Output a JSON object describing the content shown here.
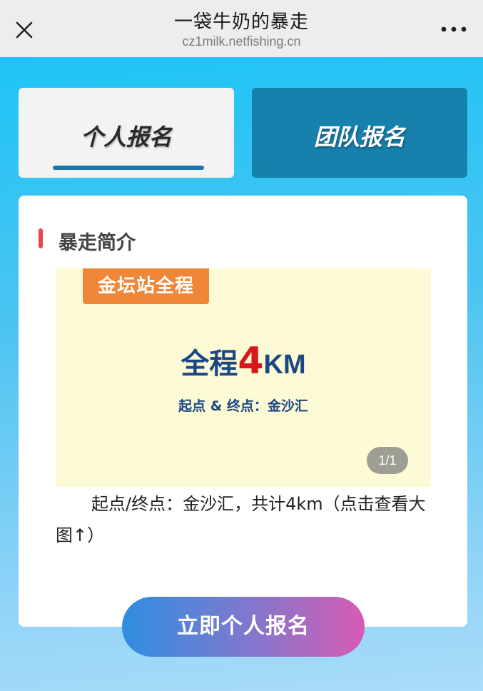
{
  "header": {
    "title": "一袋牛奶的暴走",
    "url": "cz1milk.netfishing.cn",
    "close_icon": "close-icon",
    "more_icon": "more-dots-icon"
  },
  "tabs": [
    {
      "label": "个人报名",
      "active": true
    },
    {
      "label": "团队报名",
      "active": false
    }
  ],
  "section": {
    "title": "暴走简介"
  },
  "promo": {
    "badge": "金坛站全程",
    "main_prefix": "全程",
    "main_number": "4",
    "main_unit": "KM",
    "subtitle": "起点 & 终点：金沙汇",
    "counter": "1/1"
  },
  "description": "起点/终点：金沙汇，共计4km（点击查看大图↑）",
  "cta": {
    "label": "立即个人报名"
  },
  "colors": {
    "accent_blue": "#1780ad",
    "badge_orange": "#f08637",
    "highlight_red": "#d8171c",
    "section_bar_red": "#e8464a"
  }
}
